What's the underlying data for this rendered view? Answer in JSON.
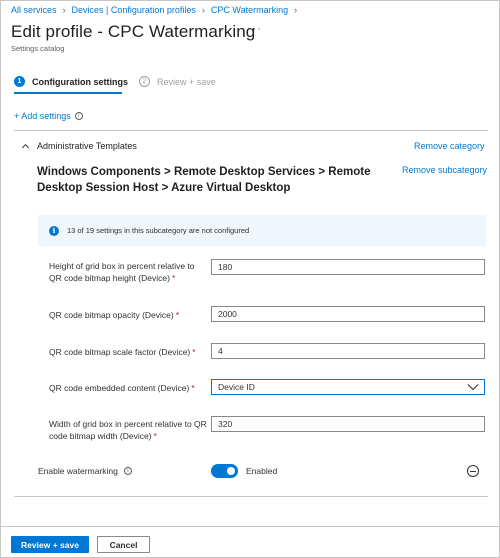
{
  "breadcrumb": {
    "items": [
      "All services",
      "Devices | Configuration profiles",
      "CPC Watermarking"
    ]
  },
  "header": {
    "title": "Edit profile - CPC Watermarking",
    "more_label": "···",
    "subtitle": "Settings catalog"
  },
  "wizard": {
    "steps": [
      {
        "number": "1",
        "label": "Configuration settings",
        "state": "active"
      },
      {
        "number": "2",
        "label": "Review + save",
        "state": "inactive"
      }
    ]
  },
  "add_settings": {
    "label": "+ Add settings",
    "info_icon": "info-icon"
  },
  "category": {
    "title": "Administrative Templates",
    "remove_label": "Remove category",
    "expanded": true
  },
  "subcategory": {
    "title": "Windows Components > Remote Desktop Services > Remote Desktop Session Host > Azure Virtual Desktop",
    "remove_label": "Remove subcategory"
  },
  "info_banner": {
    "icon": "info-icon",
    "text": "13 of 19 settings in this subcategory are not configured"
  },
  "settings": [
    {
      "label": "Height of grid box in percent relative to QR code bitmap height (Device)",
      "value": "180",
      "type": "text"
    },
    {
      "label": "QR code bitmap opacity (Device)",
      "value": "2000",
      "type": "text"
    },
    {
      "label": "QR code bitmap scale factor (Device)",
      "value": "4",
      "type": "text"
    },
    {
      "label": "QR code embedded content (Device)",
      "value": "Device ID",
      "type": "dropdown"
    },
    {
      "label": "Width of grid box in percent relative to QR code bitmap width (Device)",
      "value": "320",
      "type": "text"
    }
  ],
  "required_marker": "*",
  "watermarking": {
    "label": "Enable watermarking",
    "state_label": "Enabled",
    "enabled": true
  },
  "footer": {
    "primary_label": "Review + save",
    "secondary_label": "Cancel"
  },
  "colors": {
    "accent": "#0078d4",
    "required": "#a4262c",
    "banner_bg": "#eff6fc"
  }
}
